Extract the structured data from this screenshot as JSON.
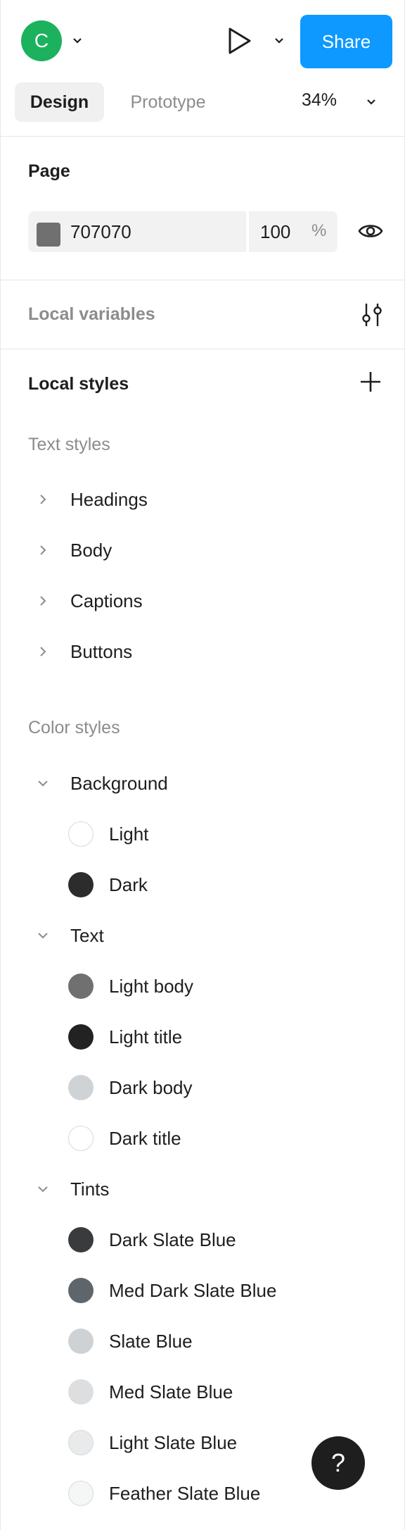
{
  "header": {
    "avatar_letter": "C",
    "share_label": "Share",
    "tabs": [
      {
        "label": "Design",
        "active": true
      },
      {
        "label": "Prototype",
        "active": false
      }
    ],
    "zoom": "34%"
  },
  "page_section": {
    "title": "Page",
    "color_hex": "707070",
    "opacity": "100",
    "opacity_unit": "%",
    "swatch_color": "#707070"
  },
  "local_variables": {
    "label": "Local variables"
  },
  "local_styles": {
    "title": "Local styles",
    "text_styles_title": "Text styles",
    "text_groups": [
      "Headings",
      "Body",
      "Captions",
      "Buttons"
    ],
    "color_styles_title": "Color styles",
    "color_groups": [
      {
        "name": "Background",
        "items": [
          {
            "name": "Light",
            "color": "#ffffff"
          },
          {
            "name": "Dark",
            "color": "#2c2c2c"
          }
        ]
      },
      {
        "name": "Text",
        "items": [
          {
            "name": "Light body",
            "color": "#707070"
          },
          {
            "name": "Light title",
            "color": "#222222"
          },
          {
            "name": "Dark body",
            "color": "#d0d3d6"
          },
          {
            "name": "Dark title",
            "color": "#ffffff"
          }
        ]
      },
      {
        "name": "Tints",
        "items": [
          {
            "name": "Dark Slate Blue",
            "color": "#3a3b3c"
          },
          {
            "name": "Med Dark Slate Blue",
            "color": "#5f666b"
          },
          {
            "name": "Slate Blue",
            "color": "#cfd2d5"
          },
          {
            "name": "Med Slate Blue",
            "color": "#dcdedf"
          },
          {
            "name": "Light Slate Blue",
            "color": "#e9eaeb"
          },
          {
            "name": "Feather Slate Blue",
            "color": "#f5f6f6"
          }
        ]
      }
    ]
  },
  "help": {
    "label": "?"
  }
}
